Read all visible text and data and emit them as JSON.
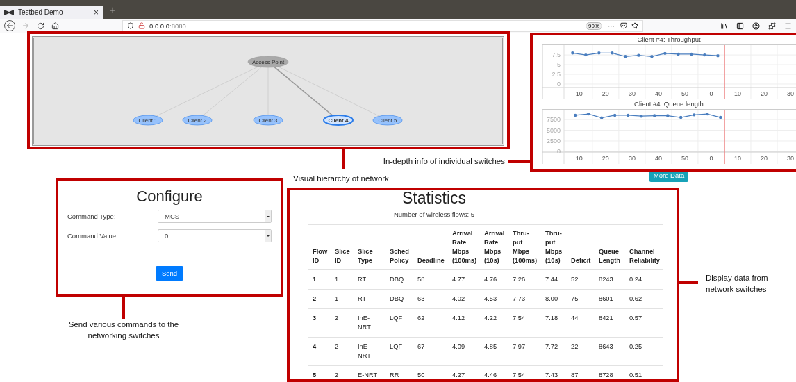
{
  "browser": {
    "tab": {
      "title": "Testbed Demo",
      "close": "×"
    },
    "new_tab": "+",
    "url": {
      "host": "0.0.0.0",
      "port": ":8080"
    },
    "zoom": "90%",
    "page_actions": "···"
  },
  "network": {
    "nodes": [
      {
        "label": "Access Point",
        "kind": "hub",
        "selected": false
      },
      {
        "label": "Client 1",
        "kind": "client",
        "selected": false
      },
      {
        "label": "Client 2",
        "kind": "client",
        "selected": false
      },
      {
        "label": "Client 3",
        "kind": "client",
        "selected": false
      },
      {
        "label": "Client 4",
        "kind": "client",
        "selected": true
      },
      {
        "label": "Client 5",
        "kind": "client",
        "selected": false
      }
    ]
  },
  "charts": [
    {
      "x_axis_labels": [
        "10",
        "20",
        "30",
        "40",
        "50",
        "0",
        "10",
        "20",
        "30"
      ],
      "chart_data": {
        "type": "line",
        "title": "Client #4: Throughput",
        "series": [
          {
            "color": "#4a7ebf",
            "values": [
              8.0,
              7.5,
              8.0,
              8.0,
              7.1,
              7.4,
              7.1,
              7.9,
              7.7,
              7.7,
              7.5,
              7.3
            ]
          }
        ],
        "ylim": [
          -0.9,
          10.2
        ],
        "yticks": [
          0,
          2.5,
          5,
          7.5
        ],
        "grid": true
      }
    },
    {
      "x_axis_labels": [
        "10",
        "20",
        "30",
        "40",
        "50",
        "0",
        "10",
        "20",
        "30"
      ],
      "chart_data": {
        "type": "line",
        "title": "Client #4: Queue length",
        "series": [
          {
            "color": "#4a7ebf",
            "values": [
              8500,
              8800,
              7900,
              8500,
              8500,
              8300,
              8400,
              8400,
              8000,
              8600,
              8800,
              8000
            ]
          }
        ],
        "ylim": [
          -100,
          9950
        ],
        "yticks": [
          0,
          2500,
          5000,
          7500
        ],
        "grid": true
      }
    }
  ],
  "more_data_button": "More Data",
  "configure": {
    "title": "Configure",
    "fields": [
      {
        "label": "Command Type:",
        "value": "MCS"
      },
      {
        "label": "Command Value:",
        "value": "0"
      }
    ],
    "send_button": "Send"
  },
  "statistics": {
    "title": "Statistics",
    "subtitle": "Number of wireless flows: 5",
    "table": {
      "columns": [
        "Flow ID",
        "Slice ID",
        "Slice Type",
        "Sched Policy",
        "Deadline",
        "Arrival Rate Mbps (100ms)",
        "Arrival Rate Mbps (10s)",
        "Thru-put Mbps (100ms)",
        "Thru-put Mbps (10s)",
        "Deficit",
        "Queue Length",
        "Channel Reliability"
      ],
      "rows": [
        [
          "1",
          "1",
          "RT",
          "DBQ",
          "58",
          "4.77",
          "4.76",
          "7.26",
          "7.44",
          "52",
          "8243",
          "0.24"
        ],
        [
          "2",
          "1",
          "RT",
          "DBQ",
          "63",
          "4.02",
          "4.53",
          "7.73",
          "8.00",
          "75",
          "8601",
          "0.62"
        ],
        [
          "3",
          "2",
          "InE-NRT",
          "LQF",
          "62",
          "4.12",
          "4.22",
          "7.54",
          "7.18",
          "44",
          "8421",
          "0.57"
        ],
        [
          "4",
          "2",
          "InE-NRT",
          "LQF",
          "67",
          "4.09",
          "4.85",
          "7.97",
          "7.72",
          "22",
          "8643",
          "0.25"
        ],
        [
          "5",
          "2",
          "E-NRT",
          "RR",
          "50",
          "4.27",
          "4.46",
          "7.54",
          "7.43",
          "87",
          "8728",
          "0.51"
        ]
      ]
    }
  },
  "annotations": [
    {
      "text": "Visual hierarchy of network"
    },
    {
      "text": "In-depth info of individual switches"
    },
    {
      "text": "Send various commands to the networking switches"
    },
    {
      "text": "Display data from network switches"
    }
  ]
}
